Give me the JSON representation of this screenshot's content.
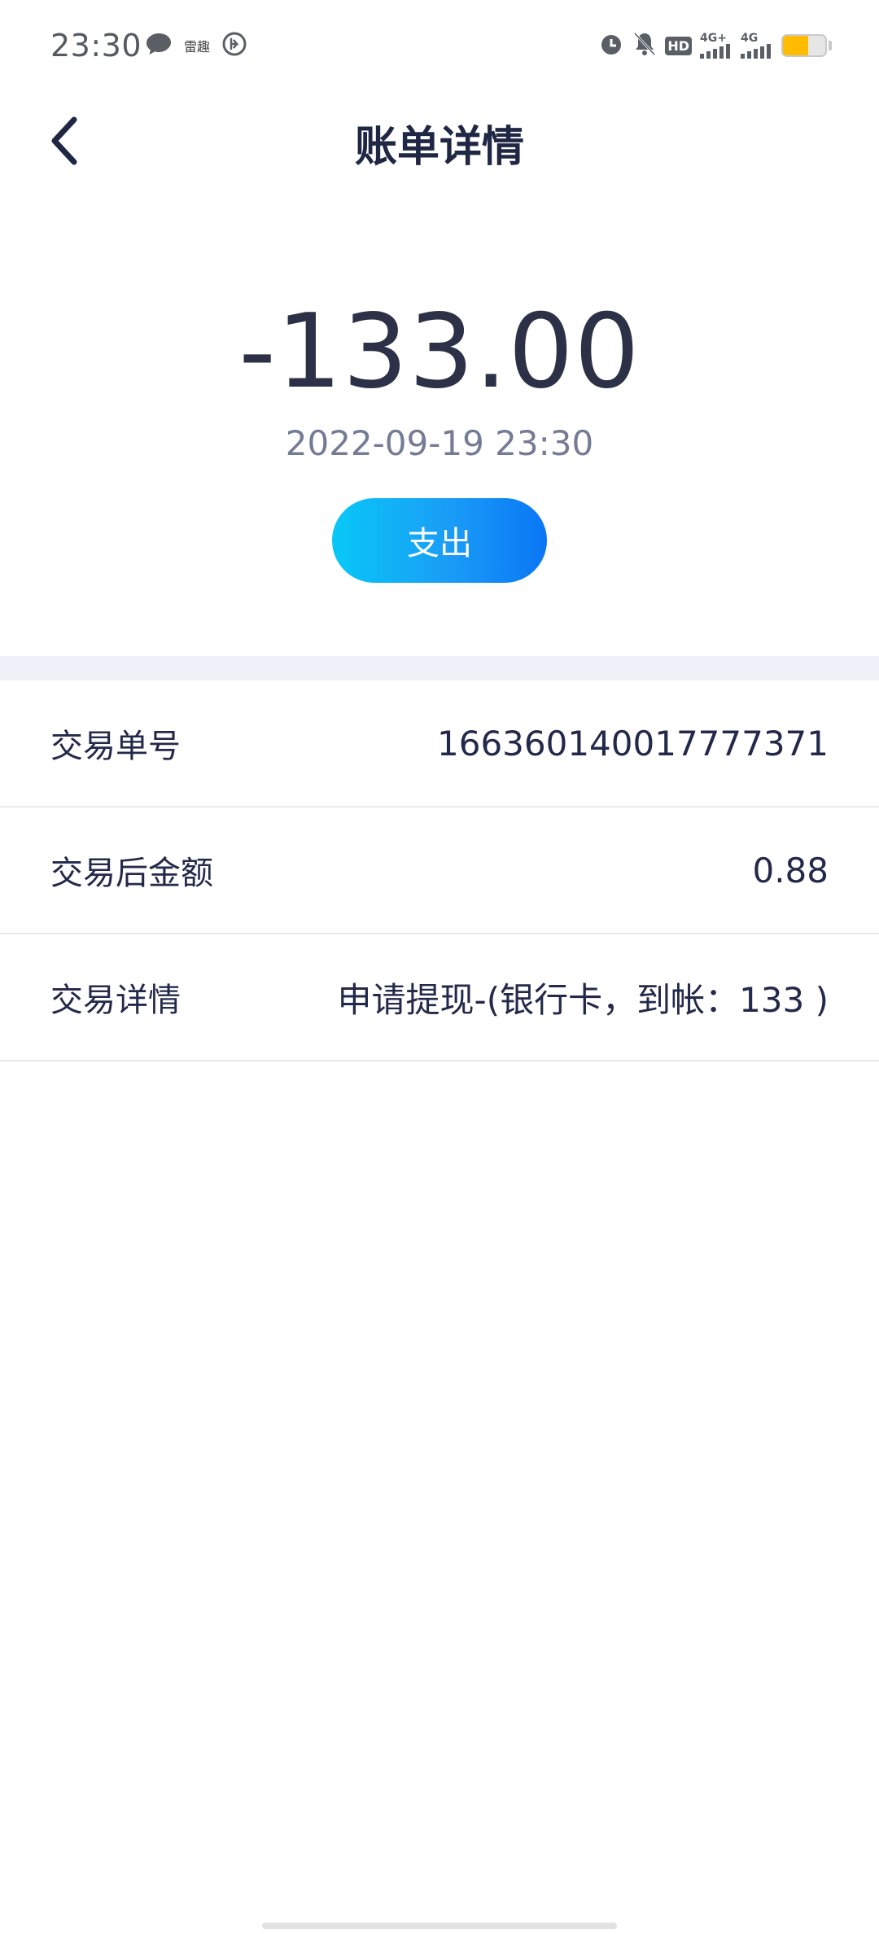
{
  "status_bar": {
    "time": "23:30",
    "left_icons": [
      "message-bubble-icon",
      "app-notification-icon",
      "vpn-circle-icon"
    ],
    "small_label": "雷趣",
    "right_icons": [
      "alarm-icon",
      "mute-bell-icon",
      "hd-icon",
      "signal-4g-plus-icon",
      "signal-4g-icon",
      "battery-icon"
    ],
    "hd_label": "HD",
    "net1_label": "4G+",
    "net2_label": "4G",
    "battery_level": 0.6,
    "battery_color": "#ffbc00"
  },
  "header": {
    "title": "账单详情",
    "back_icon": "chevron-left-icon"
  },
  "transaction": {
    "amount": "-133.00",
    "datetime": "2022-09-19 23:30",
    "type_label": "支出"
  },
  "details": [
    {
      "label": "交易单号",
      "value": "1663601400177773​71"
    },
    {
      "label": "交易后金额",
      "value": "0.88"
    },
    {
      "label": "交易详情",
      "value": "申请提现-(银行卡，到帐：133 )"
    }
  ],
  "colors": {
    "title": "#1f2745",
    "amount": "#2c3148",
    "datetime": "#747b95",
    "pill_start": "#08c8f7",
    "pill_end": "#0a76f5",
    "band": "#eef1f8"
  }
}
